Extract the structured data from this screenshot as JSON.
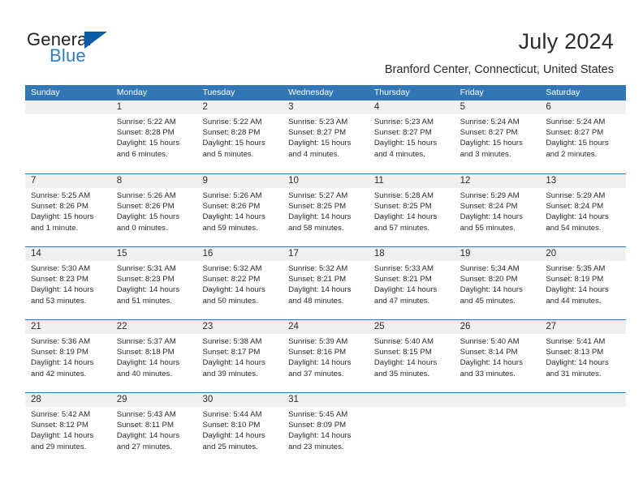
{
  "brand": {
    "name_primary": "General",
    "name_secondary": "Blue",
    "triangle_color": "#0d5ca8",
    "blue_text_color": "#2e7fc1"
  },
  "header": {
    "title": "July 2024",
    "location": "Branford Center, Connecticut, United States"
  },
  "theme": {
    "header_blue": "#3177b6",
    "day_band_gray": "#f0f0f0",
    "text_color": "#2b2b2b"
  },
  "weekdays": [
    "Sunday",
    "Monday",
    "Tuesday",
    "Wednesday",
    "Thursday",
    "Friday",
    "Saturday"
  ],
  "weeks": [
    [
      {
        "day": "",
        "sunrise": "",
        "sunset": "",
        "daylight": ""
      },
      {
        "day": "1",
        "sunrise": "Sunrise: 5:22 AM",
        "sunset": "Sunset: 8:28 PM",
        "daylight": "Daylight: 15 hours and 6 minutes."
      },
      {
        "day": "2",
        "sunrise": "Sunrise: 5:22 AM",
        "sunset": "Sunset: 8:28 PM",
        "daylight": "Daylight: 15 hours and 5 minutes."
      },
      {
        "day": "3",
        "sunrise": "Sunrise: 5:23 AM",
        "sunset": "Sunset: 8:27 PM",
        "daylight": "Daylight: 15 hours and 4 minutes."
      },
      {
        "day": "4",
        "sunrise": "Sunrise: 5:23 AM",
        "sunset": "Sunset: 8:27 PM",
        "daylight": "Daylight: 15 hours and 4 minutes."
      },
      {
        "day": "5",
        "sunrise": "Sunrise: 5:24 AM",
        "sunset": "Sunset: 8:27 PM",
        "daylight": "Daylight: 15 hours and 3 minutes."
      },
      {
        "day": "6",
        "sunrise": "Sunrise: 5:24 AM",
        "sunset": "Sunset: 8:27 PM",
        "daylight": "Daylight: 15 hours and 2 minutes."
      }
    ],
    [
      {
        "day": "7",
        "sunrise": "Sunrise: 5:25 AM",
        "sunset": "Sunset: 8:26 PM",
        "daylight": "Daylight: 15 hours and 1 minute."
      },
      {
        "day": "8",
        "sunrise": "Sunrise: 5:26 AM",
        "sunset": "Sunset: 8:26 PM",
        "daylight": "Daylight: 15 hours and 0 minutes."
      },
      {
        "day": "9",
        "sunrise": "Sunrise: 5:26 AM",
        "sunset": "Sunset: 8:26 PM",
        "daylight": "Daylight: 14 hours and 59 minutes."
      },
      {
        "day": "10",
        "sunrise": "Sunrise: 5:27 AM",
        "sunset": "Sunset: 8:25 PM",
        "daylight": "Daylight: 14 hours and 58 minutes."
      },
      {
        "day": "11",
        "sunrise": "Sunrise: 5:28 AM",
        "sunset": "Sunset: 8:25 PM",
        "daylight": "Daylight: 14 hours and 57 minutes."
      },
      {
        "day": "12",
        "sunrise": "Sunrise: 5:29 AM",
        "sunset": "Sunset: 8:24 PM",
        "daylight": "Daylight: 14 hours and 55 minutes."
      },
      {
        "day": "13",
        "sunrise": "Sunrise: 5:29 AM",
        "sunset": "Sunset: 8:24 PM",
        "daylight": "Daylight: 14 hours and 54 minutes."
      }
    ],
    [
      {
        "day": "14",
        "sunrise": "Sunrise: 5:30 AM",
        "sunset": "Sunset: 8:23 PM",
        "daylight": "Daylight: 14 hours and 53 minutes."
      },
      {
        "day": "15",
        "sunrise": "Sunrise: 5:31 AM",
        "sunset": "Sunset: 8:23 PM",
        "daylight": "Daylight: 14 hours and 51 minutes."
      },
      {
        "day": "16",
        "sunrise": "Sunrise: 5:32 AM",
        "sunset": "Sunset: 8:22 PM",
        "daylight": "Daylight: 14 hours and 50 minutes."
      },
      {
        "day": "17",
        "sunrise": "Sunrise: 5:32 AM",
        "sunset": "Sunset: 8:21 PM",
        "daylight": "Daylight: 14 hours and 48 minutes."
      },
      {
        "day": "18",
        "sunrise": "Sunrise: 5:33 AM",
        "sunset": "Sunset: 8:21 PM",
        "daylight": "Daylight: 14 hours and 47 minutes."
      },
      {
        "day": "19",
        "sunrise": "Sunrise: 5:34 AM",
        "sunset": "Sunset: 8:20 PM",
        "daylight": "Daylight: 14 hours and 45 minutes."
      },
      {
        "day": "20",
        "sunrise": "Sunrise: 5:35 AM",
        "sunset": "Sunset: 8:19 PM",
        "daylight": "Daylight: 14 hours and 44 minutes."
      }
    ],
    [
      {
        "day": "21",
        "sunrise": "Sunrise: 5:36 AM",
        "sunset": "Sunset: 8:19 PM",
        "daylight": "Daylight: 14 hours and 42 minutes."
      },
      {
        "day": "22",
        "sunrise": "Sunrise: 5:37 AM",
        "sunset": "Sunset: 8:18 PM",
        "daylight": "Daylight: 14 hours and 40 minutes."
      },
      {
        "day": "23",
        "sunrise": "Sunrise: 5:38 AM",
        "sunset": "Sunset: 8:17 PM",
        "daylight": "Daylight: 14 hours and 39 minutes."
      },
      {
        "day": "24",
        "sunrise": "Sunrise: 5:39 AM",
        "sunset": "Sunset: 8:16 PM",
        "daylight": "Daylight: 14 hours and 37 minutes."
      },
      {
        "day": "25",
        "sunrise": "Sunrise: 5:40 AM",
        "sunset": "Sunset: 8:15 PM",
        "daylight": "Daylight: 14 hours and 35 minutes."
      },
      {
        "day": "26",
        "sunrise": "Sunrise: 5:40 AM",
        "sunset": "Sunset: 8:14 PM",
        "daylight": "Daylight: 14 hours and 33 minutes."
      },
      {
        "day": "27",
        "sunrise": "Sunrise: 5:41 AM",
        "sunset": "Sunset: 8:13 PM",
        "daylight": "Daylight: 14 hours and 31 minutes."
      }
    ],
    [
      {
        "day": "28",
        "sunrise": "Sunrise: 5:42 AM",
        "sunset": "Sunset: 8:12 PM",
        "daylight": "Daylight: 14 hours and 29 minutes."
      },
      {
        "day": "29",
        "sunrise": "Sunrise: 5:43 AM",
        "sunset": "Sunset: 8:11 PM",
        "daylight": "Daylight: 14 hours and 27 minutes."
      },
      {
        "day": "30",
        "sunrise": "Sunrise: 5:44 AM",
        "sunset": "Sunset: 8:10 PM",
        "daylight": "Daylight: 14 hours and 25 minutes."
      },
      {
        "day": "31",
        "sunrise": "Sunrise: 5:45 AM",
        "sunset": "Sunset: 8:09 PM",
        "daylight": "Daylight: 14 hours and 23 minutes."
      },
      {
        "day": "",
        "sunrise": "",
        "sunset": "",
        "daylight": ""
      },
      {
        "day": "",
        "sunrise": "",
        "sunset": "",
        "daylight": ""
      },
      {
        "day": "",
        "sunrise": "",
        "sunset": "",
        "daylight": ""
      }
    ]
  ]
}
